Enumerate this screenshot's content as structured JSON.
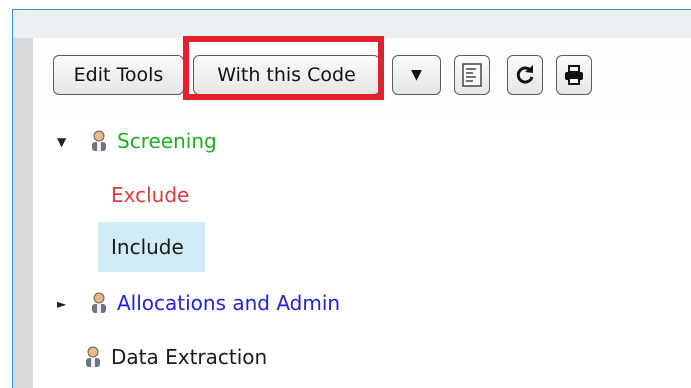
{
  "colors": {
    "highlight": "#e0202a",
    "screening": "#1fb01f",
    "exclude": "#e23b3b",
    "allocations": "#2323d8",
    "selected_bg": "#d2ebf9"
  },
  "toolbar": {
    "edit_tools_label": "Edit Tools",
    "with_this_code_label": "With this Code",
    "dropdown_glyph": "▼",
    "icons": [
      "list-icon",
      "refresh-icon",
      "print-icon"
    ]
  },
  "tree": {
    "screening": {
      "label": "Screening",
      "expanded": true,
      "arrow": "▼"
    },
    "exclude": {
      "label": "Exclude"
    },
    "include": {
      "label": "Include",
      "selected": true
    },
    "allocations": {
      "label": "Allocations and Admin",
      "expanded": false,
      "arrow": "►"
    },
    "data_extraction": {
      "label": "Data Extraction"
    }
  }
}
